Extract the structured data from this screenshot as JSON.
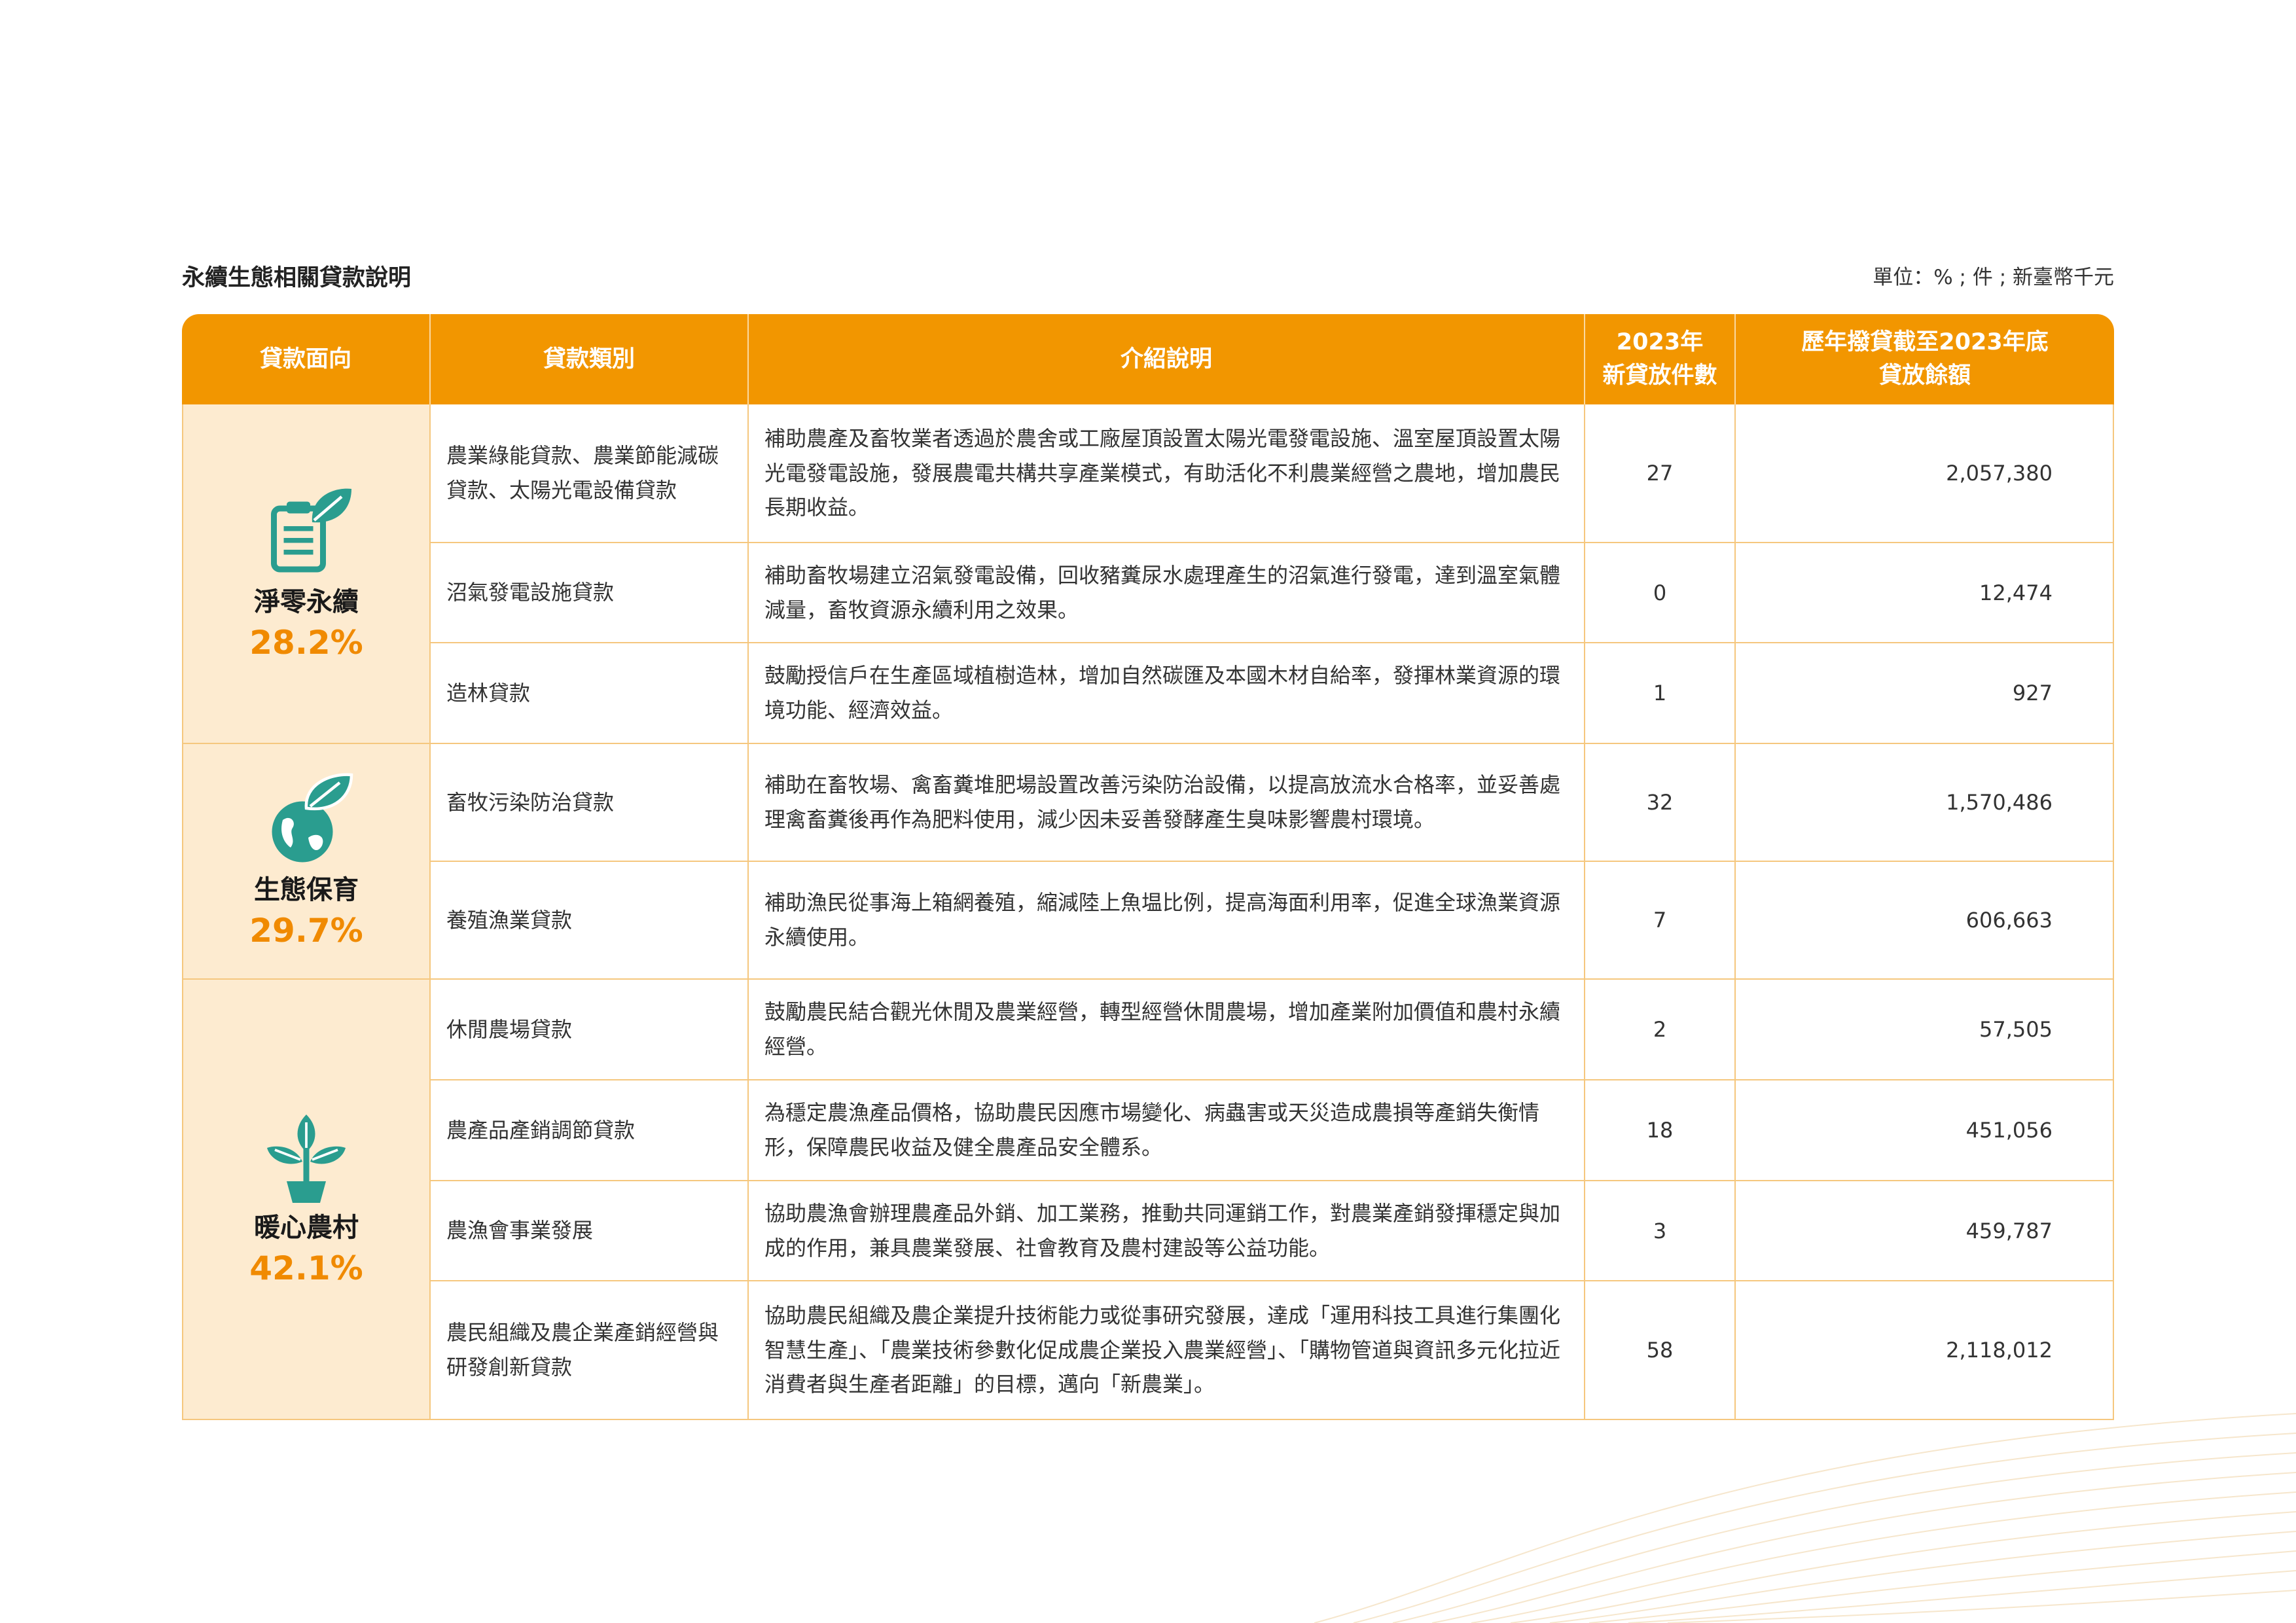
{
  "page": {
    "title": "永續生態相關貸款說明",
    "unit": "單位：% ; 件 ; 新臺幣千元"
  },
  "table": {
    "headers": {
      "aspect": "貸款面向",
      "category": "貸款類別",
      "description": "介紹說明",
      "count_line1": "2023年",
      "count_line2": "新貸放件數",
      "balance_line1": "歷年撥貸截至2023年底",
      "balance_line2": "貸放餘額"
    },
    "aspects": [
      {
        "name": "淨零永續",
        "percent": "28.2%",
        "icon": "clipboard-leaf-icon"
      },
      {
        "name": "生態保育",
        "percent": "29.7%",
        "icon": "globe-leaf-icon"
      },
      {
        "name": "暖心農村",
        "percent": "42.1%",
        "icon": "potted-plant-icon"
      }
    ],
    "rows": [
      {
        "category": "農業綠能貸款、農業節能減碳貸款、太陽光電設備貸款",
        "description": "補助農產及畜牧業者透過於農舍或工廠屋頂設置太陽光電發電設施、溫室屋頂設置太陽光電發電設施，發展農電共構共享產業模式，有助活化不利農業經營之農地，增加農民長期收益。",
        "count": "27",
        "balance": "2,057,380"
      },
      {
        "category": "沼氣發電設施貸款",
        "description": "補助畜牧場建立沼氣發電設備，回收豬糞尿水處理產生的沼氣進行發電，達到溫室氣體減量，畜牧資源永續利用之效果。",
        "count": "0",
        "balance": "12,474"
      },
      {
        "category": "造林貸款",
        "description": "鼓勵授信戶在生產區域植樹造林，增加自然碳匯及本國木材自給率，發揮林業資源的環境功能、經濟效益。",
        "count": "1",
        "balance": "927"
      },
      {
        "category": "畜牧污染防治貸款",
        "description": "補助在畜牧場、禽畜糞堆肥場設置改善污染防治設備，以提高放流水合格率，並妥善處理禽畜糞後再作為肥料使用，減少因未妥善發酵產生臭味影響農村環境。",
        "count": "32",
        "balance": "1,570,486"
      },
      {
        "category": "養殖漁業貸款",
        "description": "補助漁民從事海上箱網養殖，縮減陸上魚塭比例，提高海面利用率，促進全球漁業資源永續使用。",
        "count": "7",
        "balance": "606,663"
      },
      {
        "category": "休閒農場貸款",
        "description": "鼓勵農民結合觀光休閒及農業經營，轉型經營休閒農場，增加產業附加價值和農村永續經營。",
        "count": "2",
        "balance": "57,505"
      },
      {
        "category": "農產品產銷調節貸款",
        "description": "為穩定農漁產品價格，協助農民因應市場變化、病蟲害或天災造成農損等產銷失衡情形，保障農民收益及健全農產品安全體系。",
        "count": "18",
        "balance": "451,056"
      },
      {
        "category": "農漁會事業發展",
        "description": "協助農漁會辦理農產品外銷、加工業務，推動共同運銷工作，對農業產銷發揮穩定與加成的作用，兼具農業發展、社會教育及農村建設等公益功能。",
        "count": "3",
        "balance": "459,787"
      },
      {
        "category": "農民組織及農企業產銷經營與研發創新貸款",
        "description": "協助農民組織及農企業提升技術能力或從事研究發展，達成「運用科技工具進行集團化智慧生產」、「農業技術參數化促成農企業投入農業經營」、「購物管道與資訊多元化拉近消費者與生產者距離」的目標，邁向「新農業」。",
        "count": "58",
        "balance": "2,118,012"
      }
    ]
  },
  "colors": {
    "header": "#f29600",
    "aspect_bg": "#fdebd0",
    "percent": "#f08a00",
    "icon": "#2a9d8f",
    "border": "#f5c77e"
  }
}
